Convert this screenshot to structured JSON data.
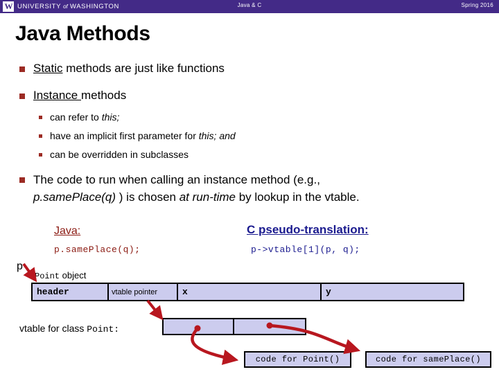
{
  "header": {
    "logo_letter": "W",
    "university_pre": "UNIVERSITY",
    "university_of": "of",
    "university_post": "WASHINGTON",
    "center_title": "Java & C",
    "right_title": "Spring 2016",
    "bar_color": "#432a87"
  },
  "slide": {
    "title": "Java Methods",
    "bullet_color": "#9c2b24",
    "bullets": [
      {
        "underlined": "Static",
        "rest": " methods are just like functions"
      },
      {
        "underlined": "Instance ",
        "rest": "methods"
      }
    ],
    "sub_bullets": [
      {
        "plain": "can refer to ",
        "italic": "this;",
        "tail": ""
      },
      {
        "plain": "have an implicit first parameter for ",
        "italic": "this; and",
        "tail": ""
      },
      {
        "plain": "can be overridden in subclasses",
        "italic": "",
        "tail": ""
      }
    ],
    "bullet3": {
      "line1": "The code to run when calling an instance method (e.g.,",
      "line2_italic1": "p.samePlace(q)",
      "line2_mid": " ) is chosen ",
      "line2_italic2": "at run-time",
      "line2_tail": "  by lookup in the vtable."
    }
  },
  "translation": {
    "java_heading": "Java:",
    "java_code": "p.samePlace(q);",
    "java_color": "#8b1a12",
    "c_heading": "C pseudo-translation:",
    "c_code": "p->vtable[1](p, q);",
    "c_color": "#1b1b8f"
  },
  "diagram": {
    "pointer_label": "p",
    "object_label_plain": "object",
    "object_label_mono": "Point",
    "object_cells": [
      {
        "text": "header",
        "mono": true
      },
      {
        "text": "vtable pointer",
        "mono": false
      },
      {
        "text": "x",
        "mono": true
      },
      {
        "text": "y",
        "mono": true
      }
    ],
    "vtable_label_plain": "vtable for class ",
    "vtable_label_mono": "Point",
    "vtable_label_colon": ":",
    "vtable_cells": [
      "",
      ""
    ],
    "code_boxes": [
      "code for Point()",
      "code for samePlace()"
    ],
    "box_fill": "#ccccee",
    "arrow_color": "#b8171f"
  }
}
